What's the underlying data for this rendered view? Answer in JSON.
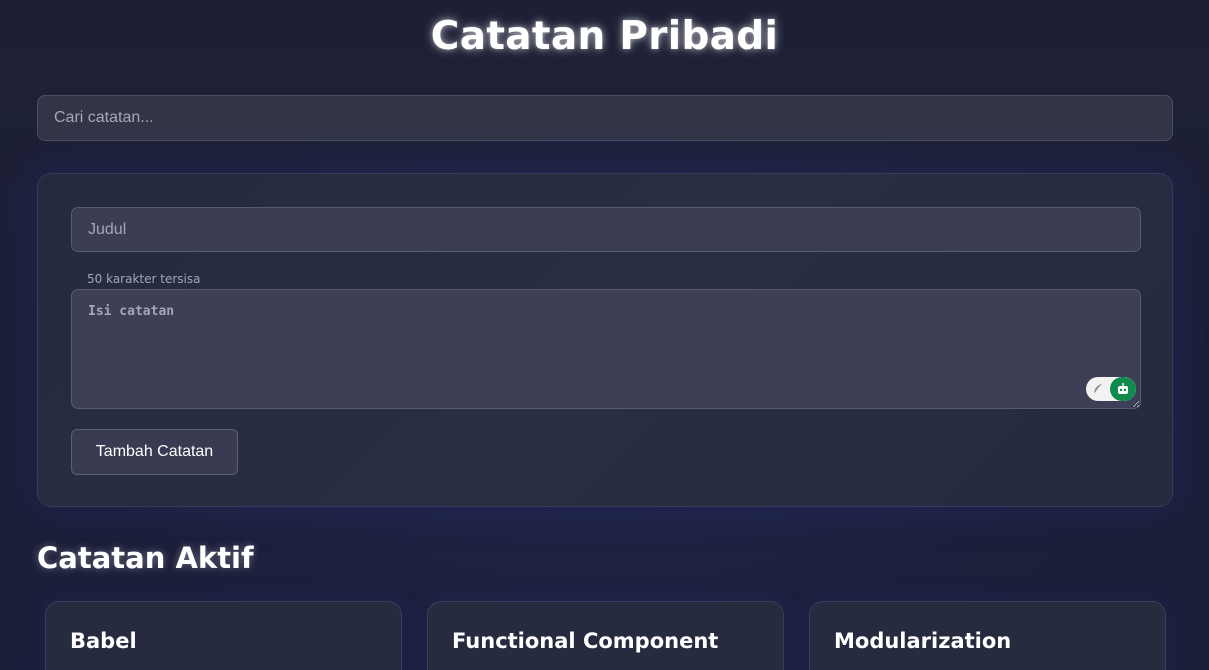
{
  "header": {
    "title": "Catatan Pribadi"
  },
  "search": {
    "placeholder": "Cari catatan..."
  },
  "form": {
    "title_placeholder": "Judul",
    "char_counter": "50 karakter tersisa",
    "body_placeholder": "Isi catatan",
    "submit_label": "Tambah Catatan",
    "extension_icons": [
      "feather-icon",
      "robot-icon"
    ]
  },
  "active_notes": {
    "heading": "Catatan Aktif",
    "items": [
      {
        "title": "Babel"
      },
      {
        "title": "Functional Component"
      },
      {
        "title": "Modularization"
      }
    ]
  },
  "colors": {
    "background": "#1c2036",
    "card": "#272b40",
    "input": "#3a3d54",
    "extension_accent": "#0d8a4c"
  }
}
